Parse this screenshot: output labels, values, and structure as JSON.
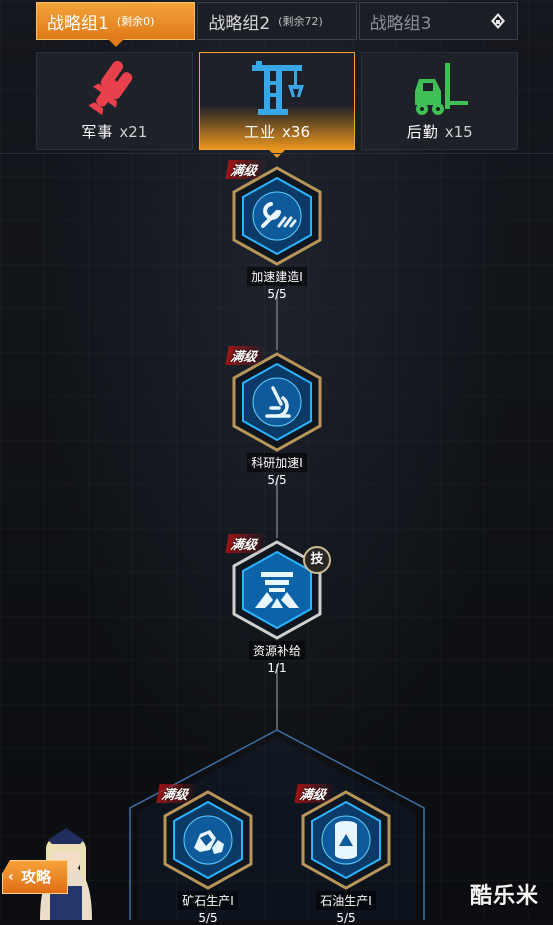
{
  "group_tabs": [
    {
      "name": "战略组1",
      "remaining": "(剩余0)"
    },
    {
      "name": "战略组2",
      "remaining": "(剩余72)"
    },
    {
      "name": "战略组3",
      "remaining": ""
    }
  ],
  "category_tabs": [
    {
      "label": "军事",
      "count": "x21",
      "icon": "rockets-icon",
      "color": "#e8404c"
    },
    {
      "label": "工业",
      "count": "x36",
      "icon": "crane-icon",
      "color": "#39a6e8"
    },
    {
      "label": "后勤",
      "count": "x15",
      "icon": "forklift-icon",
      "color": "#3fbf56"
    }
  ],
  "max_badge": "满级",
  "skill_badge": "技",
  "nodes": [
    {
      "name": "加速建造I",
      "level": "5/5",
      "icon": "wrench-speed-icon"
    },
    {
      "name": "科研加速I",
      "level": "5/5",
      "icon": "microscope-icon"
    },
    {
      "name": "资源补给",
      "level": "1/1",
      "icon": "supply-icon"
    },
    {
      "name": "矿石生产I",
      "level": "5/5",
      "icon": "ore-icon"
    },
    {
      "name": "石油生产I",
      "level": "5/5",
      "icon": "oil-barrel-icon"
    }
  ],
  "guide_button": "攻略",
  "watermark": "酷乐米",
  "colors": {
    "accent": "#f0a53a",
    "node_glow": "#1ea8f0",
    "frame_gold": "#b8965a"
  }
}
